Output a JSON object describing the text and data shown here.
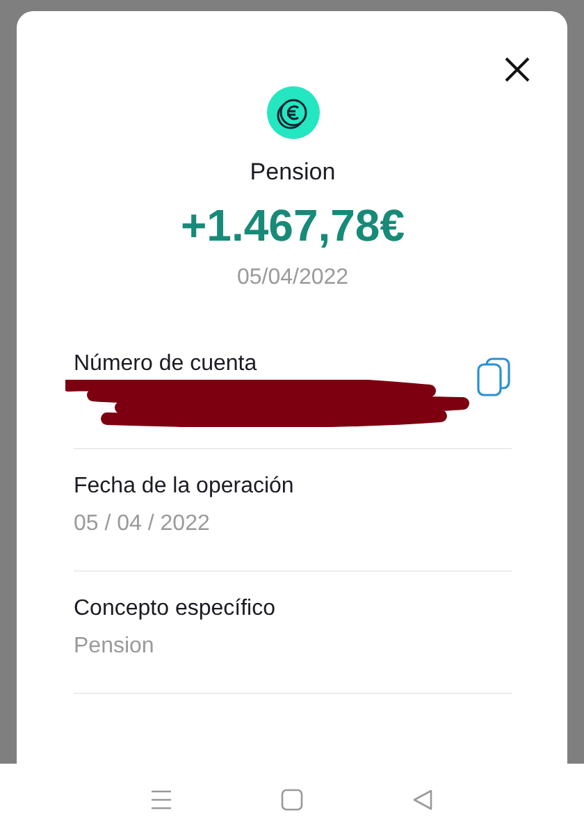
{
  "transaction": {
    "title": "Pension",
    "amount": "+1.467,78€",
    "date": "05/04/2022"
  },
  "fields": [
    {
      "label": "Número de cuenta",
      "redacted": true,
      "copyable": true
    },
    {
      "label": "Fecha de la operación",
      "value": "05 / 04 / 2022",
      "redacted": false,
      "copyable": false
    },
    {
      "label": "Concepto específico",
      "value": "Pension",
      "redacted": false,
      "copyable": false
    }
  ]
}
